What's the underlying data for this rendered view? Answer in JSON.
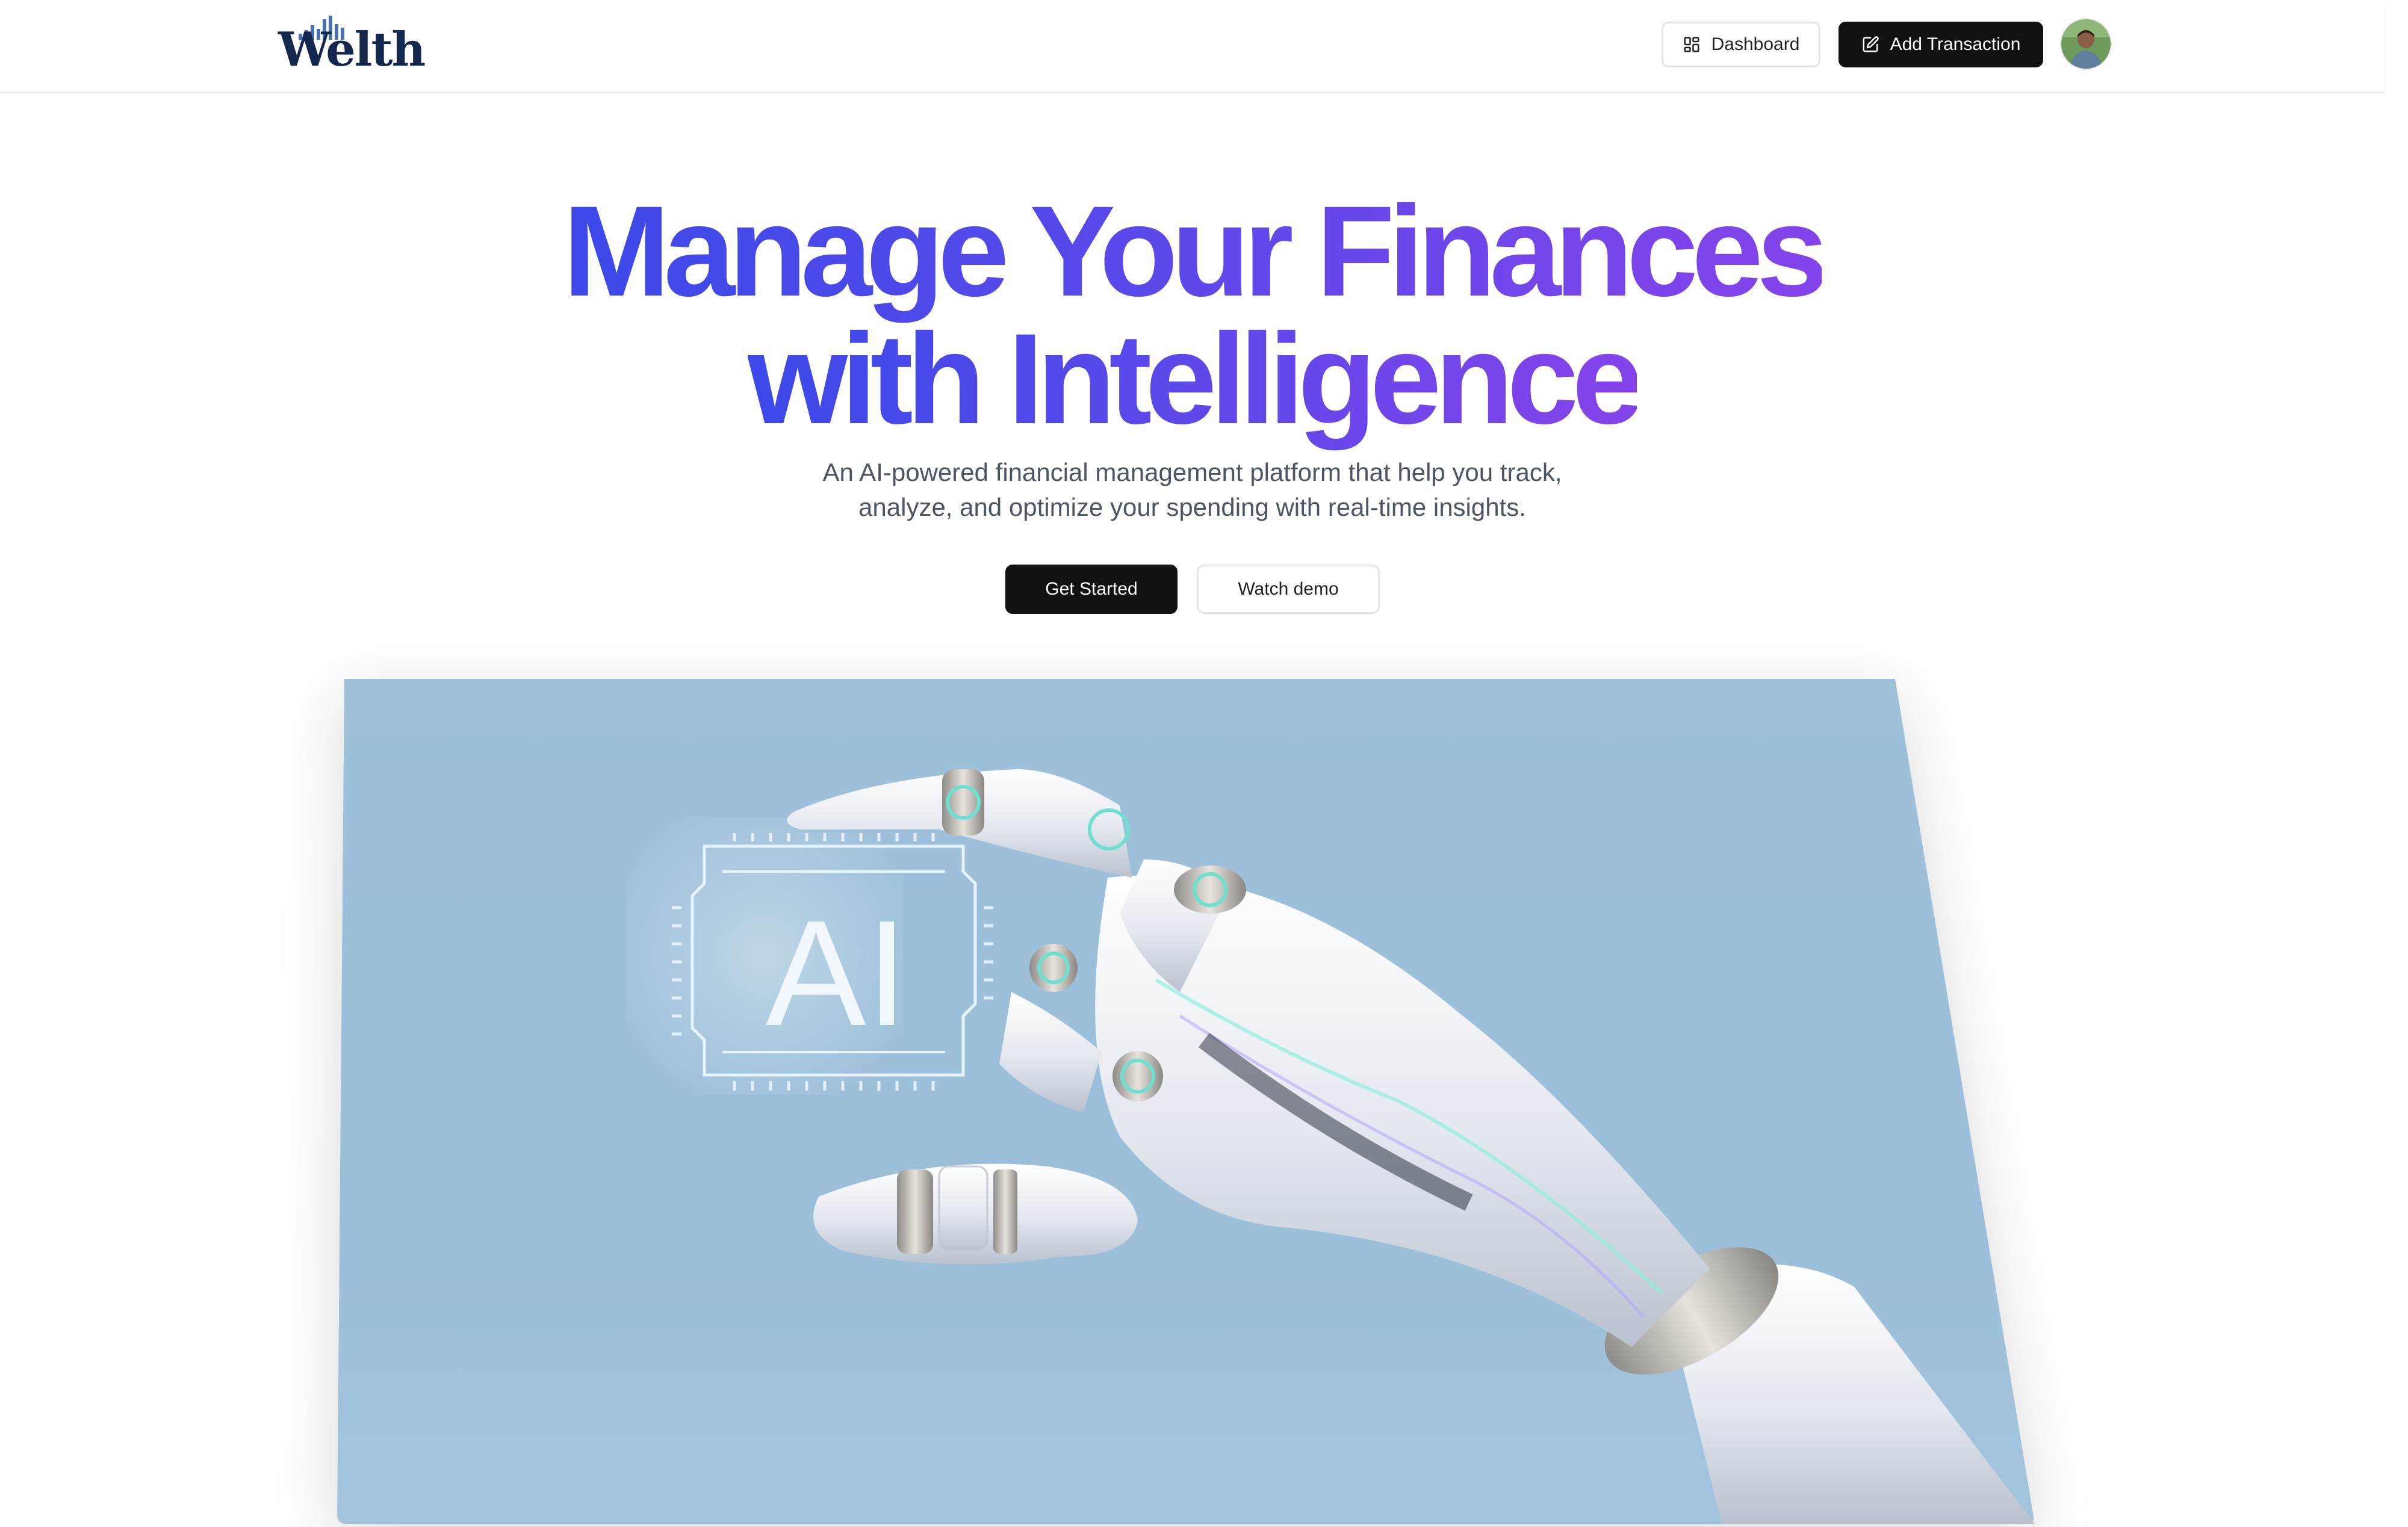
{
  "header": {
    "logo_text": "Welth",
    "dashboard_label": "Dashboard",
    "add_transaction_label": "Add Transaction",
    "avatar_alt": "User avatar"
  },
  "hero": {
    "title_line1": "Manage Your Finances",
    "title_line2": "with Intelligence",
    "subtitle_line1": "An AI-powered financial management platform that help you track,",
    "subtitle_line2": "analyze, and optimize your spending with real-time insights.",
    "get_started_label": "Get Started",
    "watch_demo_label": "Watch demo",
    "image_chip_text": "AI"
  },
  "colors": {
    "brand_navy": "#14284f",
    "gradient_start": "#3b49e8",
    "gradient_end": "#8443ea",
    "dark_button": "#111111",
    "image_background": "#9fc1da"
  },
  "icons": {
    "dashboard": "layout-dashboard-icon",
    "add_transaction": "pen-square-icon"
  }
}
